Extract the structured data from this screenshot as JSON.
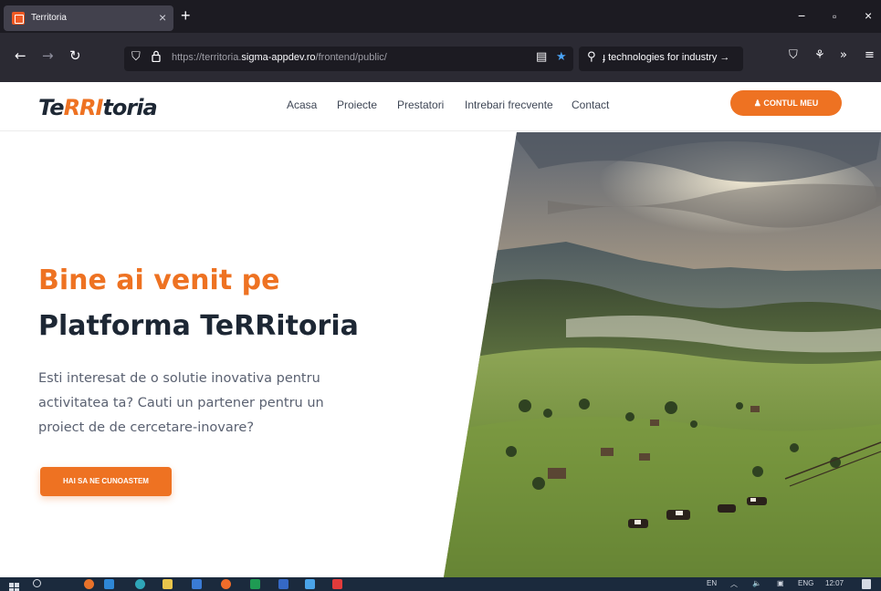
{
  "browser": {
    "tab_title": "Territoria",
    "tab_close": "×",
    "new_tab": "+",
    "url_scheme": "https://territoria.",
    "url_domain": "sigma-appdev.ro",
    "url_path": "/frontend/public/",
    "search_text": "ɟ technologies for industry →",
    "win_minimize": "−",
    "win_restore": "▫",
    "win_close": "×",
    "bookmark_color": "#4aa3f5"
  },
  "site": {
    "logo_part1": "Te",
    "logo_part2": "RRI",
    "logo_part3": "toria",
    "menu": [
      "Acasa",
      "Proiecte",
      "Prestatori",
      "Intrebari frecvente",
      "Contact"
    ],
    "account_button": "♟ CONTUL MEU",
    "accent_color": "#ee7222"
  },
  "hero": {
    "title_line1": "Bine ai venit pe",
    "title_line2": "Platforma TeRRitoria",
    "paragraph": "Esti interesat de o solutie inovativa pentru activitatea ta? Cauti un partener pentru un proiect de de cercetare-inovare?",
    "cta": "HAI SA NE CUNOASTEM"
  },
  "taskbar": {
    "lang": "EN",
    "chevron": "︿",
    "keyboard": "ENG",
    "time": "12:07"
  }
}
